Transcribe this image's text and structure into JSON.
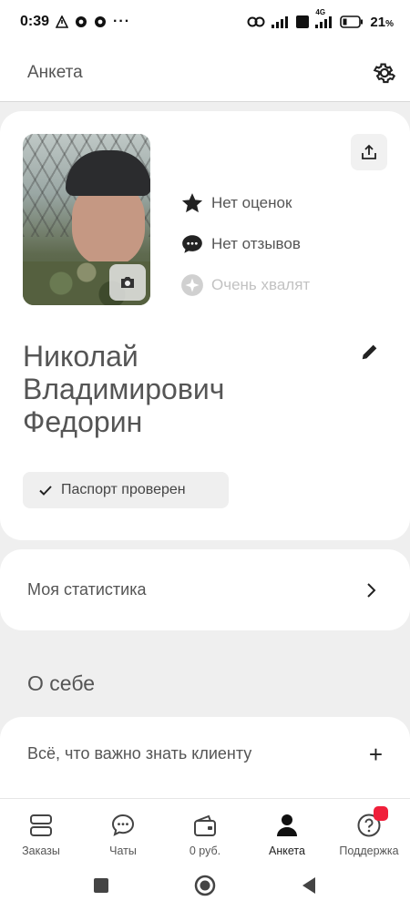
{
  "status_bar": {
    "time": "0:39",
    "dots": "···",
    "network": "4G",
    "battery": "21",
    "battery_unit": "%"
  },
  "header": {
    "title": "Анкета"
  },
  "profile": {
    "ratings": "Нет оценок",
    "reviews": "Нет отзывов",
    "praise": "Очень хвалят",
    "name_line1": "Николай",
    "name_line2": "Владимирович",
    "name_line3": "Федорин",
    "passport": "Паспорт проверен"
  },
  "stats": {
    "label": "Моя статистика"
  },
  "about": {
    "title": "О себе",
    "row_label": "Всё, что важно знать клиенту"
  },
  "nav": {
    "items": [
      {
        "label": "Заказы",
        "icon": "orders-icon"
      },
      {
        "label": "Чаты",
        "icon": "chat-icon"
      },
      {
        "label": "0 руб.",
        "icon": "wallet-icon"
      },
      {
        "label": "Анкета",
        "icon": "profile-icon"
      },
      {
        "label": "Поддержка",
        "icon": "support-icon"
      }
    ],
    "active": "Анкета"
  },
  "colors": {
    "badge": "#f01f3a",
    "background": "#efefef",
    "card": "#ffffff"
  }
}
